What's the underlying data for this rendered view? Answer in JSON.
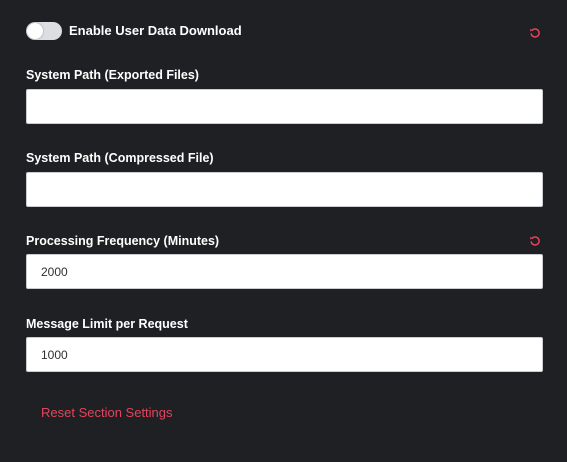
{
  "toggle": {
    "label": "Enable User Data Download",
    "state": "off"
  },
  "fields": [
    {
      "label": "System Path (Exported Files)",
      "value": "",
      "has_reset": false
    },
    {
      "label": "System Path (Compressed File)",
      "value": "",
      "has_reset": false
    },
    {
      "label": "Processing Frequency (Minutes)",
      "value": "2000",
      "has_reset": true
    },
    {
      "label": "Message Limit per Request",
      "value": "1000",
      "has_reset": false
    }
  ],
  "reset_section_label": "Reset Section Settings",
  "colors": {
    "background": "#1f2024",
    "accent_red": "#e2445c",
    "input_bg": "#ffffff"
  },
  "icons": {
    "reset": "reset-icon"
  }
}
